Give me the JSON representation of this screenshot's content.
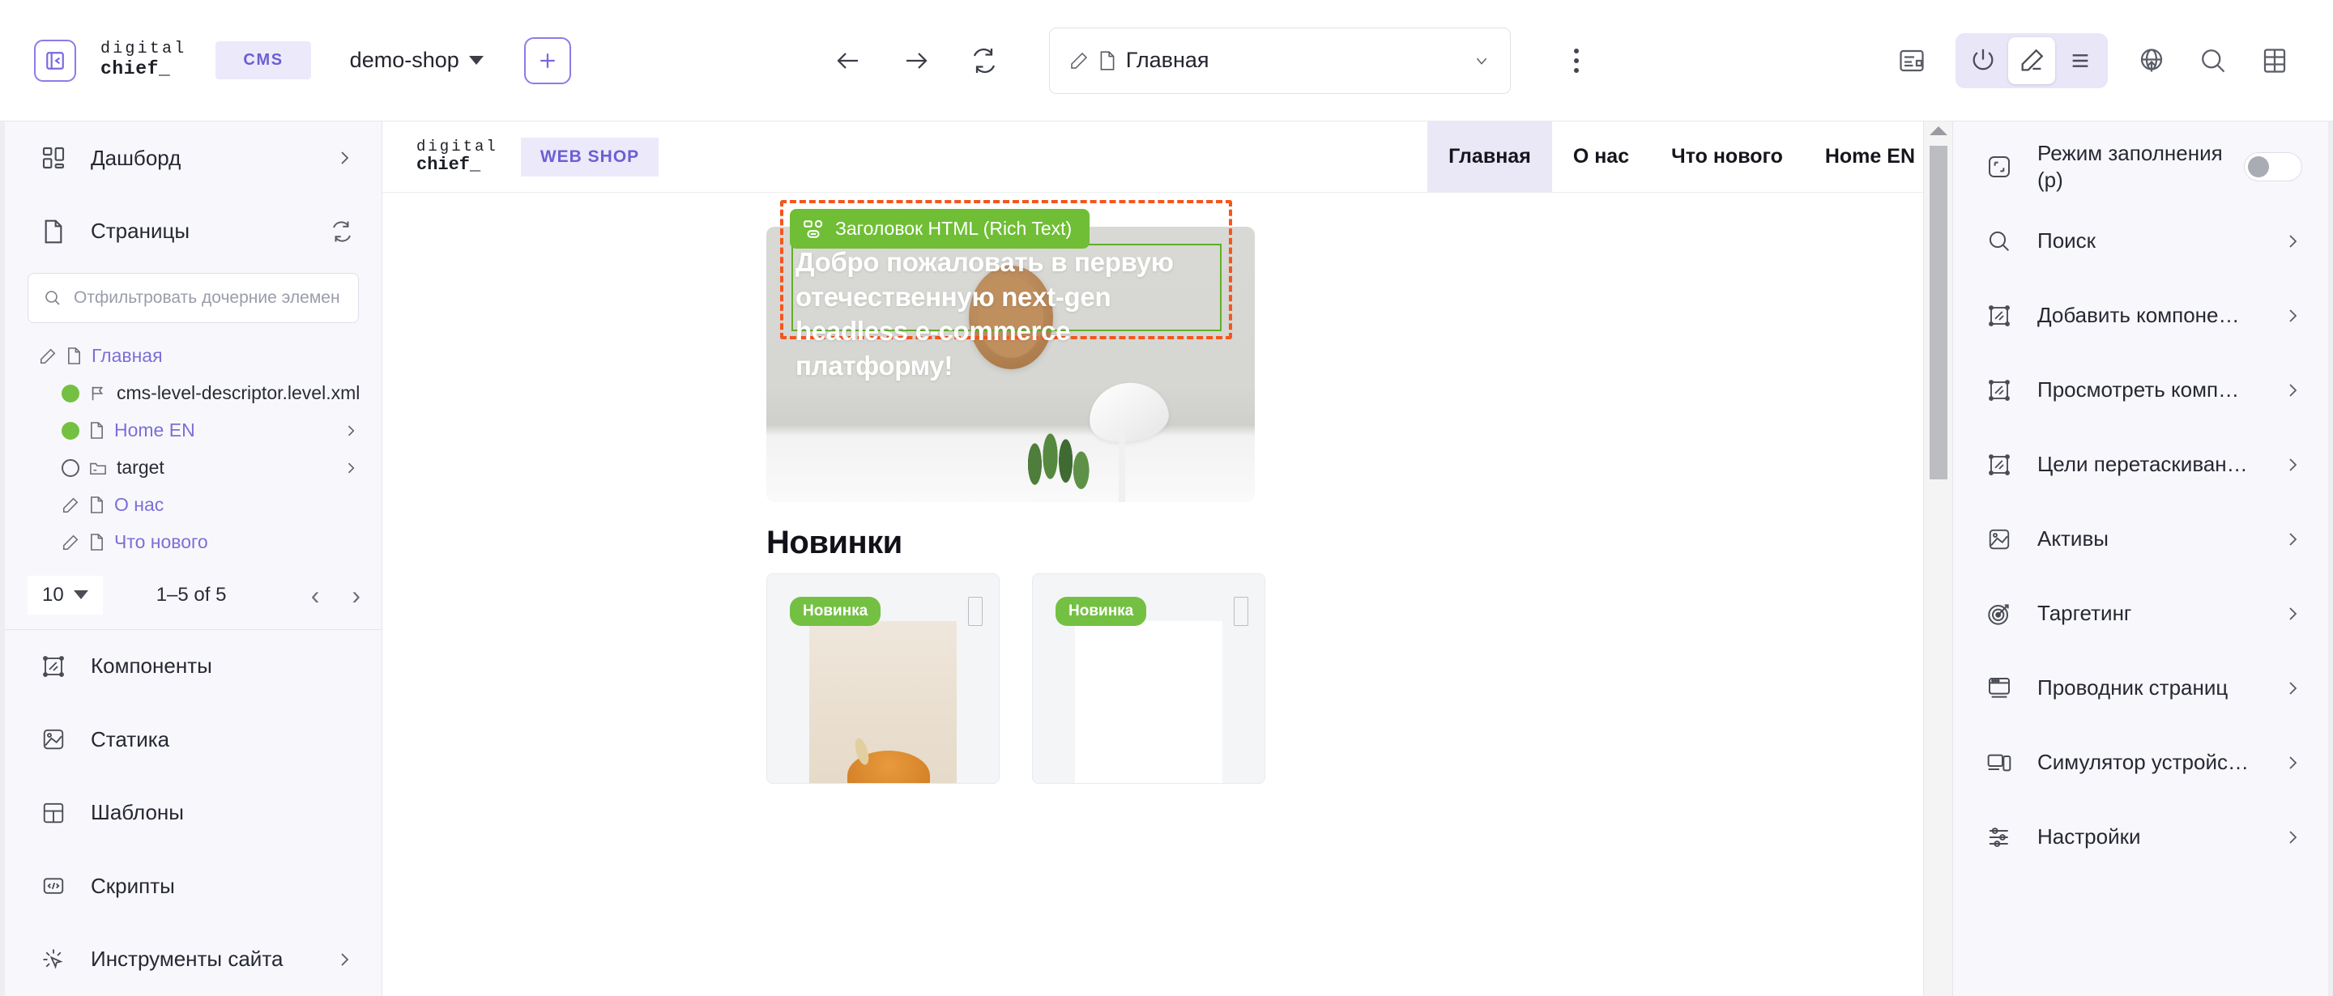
{
  "topbar": {
    "collapse_icon": "panel-collapse-icon",
    "brand_line1": "digital",
    "brand_line2": "chief_",
    "cms_badge": "CMS",
    "site_name": "demo-shop",
    "add_label": "+",
    "back_icon": "arrow-left-icon",
    "forward_icon": "arrow-right-icon",
    "refresh_icon": "refresh-icon",
    "page_field": {
      "value": "Главная",
      "edit_icon": "pencil-icon",
      "doc_icon": "document-icon",
      "chevron": "chevron-down-icon"
    },
    "kebab_icon": "more-vertical-icon",
    "right_icons": [
      {
        "name": "layout-panel-icon",
        "active": false
      },
      {
        "name": "power-icon",
        "active": false
      },
      {
        "name": "pencil-edit-icon",
        "active": true
      },
      {
        "name": "menu-lines-icon",
        "active": false
      },
      {
        "name": "globe-publish-icon",
        "active": false
      },
      {
        "name": "search-icon",
        "active": false
      },
      {
        "name": "grid-icon",
        "active": false
      }
    ]
  },
  "sidebar": {
    "dashboard": {
      "label": "Дашборд",
      "icon": "dashboard-icon",
      "chevron": "chevron-right-icon"
    },
    "pages": {
      "label": "Страницы",
      "icon": "document-icon",
      "refresh_icon": "refresh-icon"
    },
    "filter": {
      "placeholder": "Отфильтровать дочерние элемен",
      "value": "",
      "icon": "search-icon"
    },
    "tree": [
      {
        "label": "Главная",
        "icon": "document-icon",
        "lead": "pencil-icon",
        "link": true,
        "indent": false,
        "chevron": false
      },
      {
        "label": "cms-level-descriptor.level.xml",
        "icon": "flag-icon",
        "lead": "dot-green",
        "link": false,
        "indent": true,
        "chevron": false
      },
      {
        "label": "Home EN",
        "icon": "document-icon",
        "lead": "dot-green",
        "link": true,
        "indent": true,
        "chevron": true
      },
      {
        "label": "target",
        "icon": "folder-icon",
        "lead": "dot-hollow",
        "link": false,
        "indent": true,
        "chevron": true
      },
      {
        "label": "О нас",
        "icon": "document-icon",
        "lead": "pencil-icon",
        "link": true,
        "indent": true,
        "chevron": false
      },
      {
        "label": "Что нового",
        "icon": "document-icon",
        "lead": "pencil-icon",
        "link": true,
        "indent": true,
        "chevron": false
      }
    ],
    "pager": {
      "page_size": "10",
      "range": "1–5 of 5",
      "prev": "‹",
      "next": "›"
    },
    "nav": [
      {
        "label": "Компоненты",
        "icon": "components-icon",
        "chevron": false
      },
      {
        "label": "Статика",
        "icon": "static-image-icon",
        "chevron": false
      },
      {
        "label": "Шаблоны",
        "icon": "templates-icon",
        "chevron": false
      },
      {
        "label": "Скрипты",
        "icon": "code-icon",
        "chevron": false
      },
      {
        "label": "Инструменты сайта",
        "icon": "site-tools-icon",
        "chevron": true
      }
    ]
  },
  "canvas": {
    "site_header": {
      "brand_line1": "digital",
      "brand_line2": "chief_",
      "shop_badge": "WEB SHOP",
      "nav": [
        {
          "label": "Главная",
          "active": true
        },
        {
          "label": "О нас",
          "active": false
        },
        {
          "label": "Что нового",
          "active": false
        },
        {
          "label": "Home EN",
          "active": false
        }
      ]
    },
    "selection": {
      "badge_label": "Заголовок HTML (Rich Text)",
      "badge_icon": "component-blocks-icon",
      "badge_color": "#6fbe35",
      "outline_color": "#f4561f",
      "inner_outline_color": "#5fb028"
    },
    "hero_text": "Добро пожаловать в первую отечественную next-gen headless e-commerce платформу!",
    "section_title": "Новинки",
    "cards": [
      {
        "badge": "Новинка",
        "has_photo": true
      },
      {
        "badge": "Новинка",
        "has_photo": false
      }
    ],
    "scrollbar": {
      "up_icon": "scroll-up-arrow",
      "thumb": "scroll-thumb"
    }
  },
  "rpanel": {
    "items": [
      {
        "label": "Режим заполнения (p)",
        "icon": "fill-mode-icon",
        "control": "toggle",
        "toggle_on": false
      },
      {
        "label": "Поиск",
        "icon": "search-icon",
        "control": "chevron"
      },
      {
        "label": "Добавить компоне…",
        "icon": "components-icon",
        "control": "chevron"
      },
      {
        "label": "Просмотреть комп…",
        "icon": "components-icon",
        "control": "chevron"
      },
      {
        "label": "Цели перетаскиван…",
        "icon": "components-icon",
        "control": "chevron"
      },
      {
        "label": "Активы",
        "icon": "static-image-icon",
        "control": "chevron"
      },
      {
        "label": "Таргетинг",
        "icon": "target-icon",
        "control": "chevron"
      },
      {
        "label": "Проводник страниц",
        "icon": "page-explorer-icon",
        "control": "chevron"
      },
      {
        "label": "Симулятор устройс…",
        "icon": "device-simulator-icon",
        "control": "chevron"
      },
      {
        "label": "Настройки",
        "icon": "settings-sliders-icon",
        "control": "chevron"
      }
    ]
  },
  "colors": {
    "accent": "#7868e0",
    "green": "#74c043",
    "orange": "#f4561f",
    "badge_bg": "#ece9fb"
  }
}
